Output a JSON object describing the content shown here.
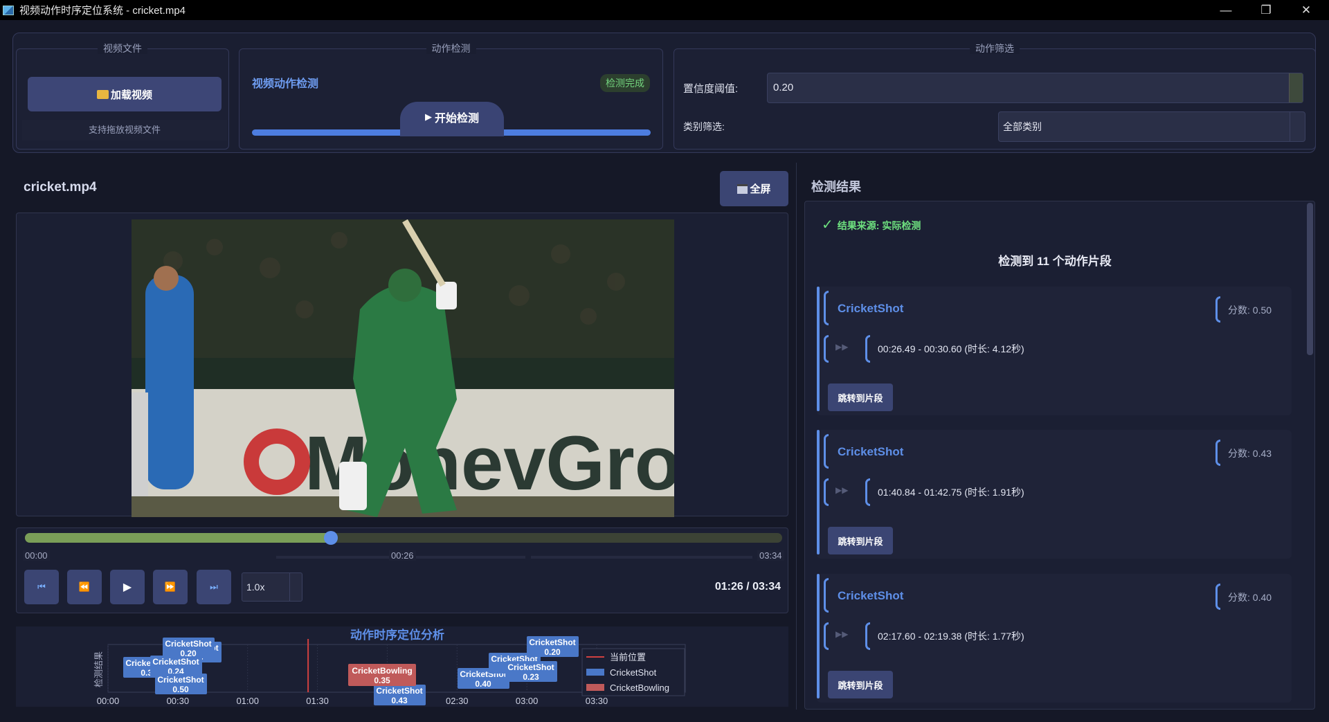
{
  "window": {
    "title": "视频动作时序定位系统 - cricket.mp4",
    "minimize": "—",
    "maximize": "❐",
    "close": "✕"
  },
  "groups": {
    "video_file": "视频文件",
    "action_detect": "动作检测",
    "action_filter": "动作筛选"
  },
  "video_file": {
    "load_icon": "folder-icon",
    "load_label": "加载视频",
    "hint": "支持拖放视频文件"
  },
  "detect": {
    "title": "视频动作检测",
    "status": "检测完成",
    "start_label": "开始检测",
    "progress": 1.0
  },
  "filter": {
    "confidence_label": "置信度阈值:",
    "confidence_value": "0.20",
    "category_label": "类别筛选:",
    "category_value": "全部类别"
  },
  "player": {
    "video_name": "cricket.mp4",
    "fullscreen_label": "全屏",
    "seek_fraction": 0.404,
    "time_start": "00:00",
    "time_mid": "00:26",
    "time_end": "03:34",
    "speed": "1.0x",
    "current_time": "01:26 / 03:34",
    "buttons": [
      "skip-start-icon",
      "rewind-icon",
      "play-icon",
      "forward-icon",
      "skip-end-icon"
    ]
  },
  "timeline": {
    "title": "动作时序定位分析",
    "ylabel": "检测结果",
    "ticks": [
      "00:00",
      "00:30",
      "01:00",
      "01:30",
      "02:00",
      "02:30",
      "03:00",
      "03:30"
    ],
    "legend": [
      "当前位置",
      "CricketShot",
      "CricketBowling"
    ],
    "colors": {
      "shot": "#4a78c8",
      "bowling": "#c05a5a",
      "current": "#d04040"
    }
  },
  "chart_data": {
    "type": "bar",
    "title": "动作时序定位分析",
    "ylabel": "检测结果",
    "x_ticks": [
      "00:00",
      "00:30",
      "01:00",
      "01:30",
      "02:00",
      "02:30",
      "03:00",
      "03:30"
    ],
    "current_position_s": 86,
    "series": [
      {
        "name": "CricketShot",
        "segments": [
          {
            "label": "CricketShot",
            "score": "0.31"
          },
          {
            "label": "CricketShot",
            "score": "0.20"
          },
          {
            "label": "CricketShot",
            "score": "0.24"
          },
          {
            "label": "CricketShot",
            "score": "0.20"
          },
          {
            "label": "CricketShot",
            "score": "0.50"
          },
          {
            "label": "CricketShot",
            "score": "0.43"
          },
          {
            "label": "CricketShot",
            "score": "0.40"
          },
          {
            "label": "CricketShot",
            "score": "0.23"
          },
          {
            "label": "CricketShot",
            "score": "0.23"
          },
          {
            "label": "CricketShot",
            "score": "0.20"
          }
        ]
      },
      {
        "name": "CricketBowling",
        "segments": [
          {
            "label": "CricketBowling",
            "score": "0.35"
          }
        ]
      }
    ]
  },
  "results": {
    "title": "检测结果",
    "source": "结果来源: 实际检测",
    "count_text": "检测到 11 个动作片段",
    "items": [
      {
        "name": "CricketShot",
        "score": "分数: 0.50",
        "range": "00:26.49 - 00:30.60 (时长: 4.12秒)",
        "jump": "跳转到片段"
      },
      {
        "name": "CricketShot",
        "score": "分数: 0.43",
        "range": "01:40.84 - 01:42.75 (时长: 1.91秒)",
        "jump": "跳转到片段"
      },
      {
        "name": "CricketShot",
        "score": "分数: 0.40",
        "range": "02:17.60 - 02:19.38 (时长: 1.77秒)",
        "jump": "跳转到片段"
      }
    ]
  }
}
